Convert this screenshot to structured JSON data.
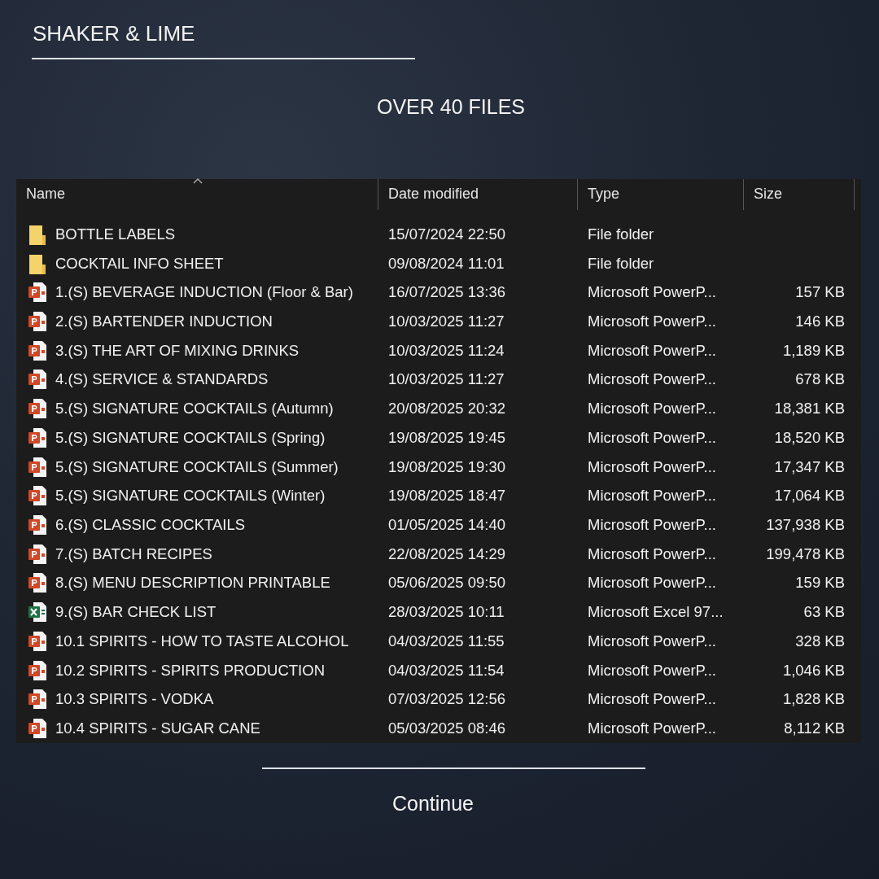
{
  "brand": "SHAKER & LIME",
  "heading": "OVER 40 FILES",
  "explorer": {
    "columns": [
      {
        "label": "Name",
        "sorted": true
      },
      {
        "label": "Date modified",
        "sorted": false
      },
      {
        "label": "Type",
        "sorted": false
      },
      {
        "label": "Size",
        "sorted": false
      }
    ],
    "rows": [
      {
        "kind": "folder",
        "name": "BOTTLE LABELS",
        "date": "15/07/2024 22:50",
        "type": "File folder"
      },
      {
        "kind": "folder",
        "name": "COCKTAIL INFO SHEET",
        "date": "09/08/2024 11:01",
        "type": "File folder"
      },
      {
        "kind": "powerpoint",
        "name": "1.(S) BEVERAGE INDUCTION (Floor & Bar)",
        "date": "16/07/2025 13:36",
        "type": "Microsoft PowerP...",
        "size": "157 KB"
      },
      {
        "kind": "powerpoint",
        "name": "2.(S) BARTENDER INDUCTION",
        "date": "10/03/2025 11:27",
        "type": "Microsoft PowerP...",
        "size": "146 KB"
      },
      {
        "kind": "powerpoint",
        "name": "3.(S) THE ART OF MIXING DRINKS",
        "date": "10/03/2025 11:24",
        "type": "Microsoft PowerP...",
        "size": "1,189 KB"
      },
      {
        "kind": "powerpoint",
        "name": "4.(S) SERVICE & STANDARDS",
        "date": "10/03/2025 11:27",
        "type": "Microsoft PowerP...",
        "size": "678 KB"
      },
      {
        "kind": "powerpoint",
        "name": "5.(S) SIGNATURE COCKTAILS (Autumn)",
        "date": "20/08/2025 20:32",
        "type": "Microsoft PowerP...",
        "size": "18,381 KB"
      },
      {
        "kind": "powerpoint",
        "name": "5.(S) SIGNATURE COCKTAILS (Spring)",
        "date": "19/08/2025 19:45",
        "type": "Microsoft PowerP...",
        "size": "18,520 KB"
      },
      {
        "kind": "powerpoint",
        "name": "5.(S) SIGNATURE COCKTAILS (Summer)",
        "date": "19/08/2025 19:30",
        "type": "Microsoft PowerP...",
        "size": "17,347 KB"
      },
      {
        "kind": "powerpoint",
        "name": "5.(S) SIGNATURE COCKTAILS (Winter)",
        "date": "19/08/2025 18:47",
        "type": "Microsoft PowerP...",
        "size": "17,064 KB"
      },
      {
        "kind": "powerpoint",
        "name": "6.(S) CLASSIC COCKTAILS",
        "date": "01/05/2025 14:40",
        "type": "Microsoft PowerP...",
        "size": "137,938 KB"
      },
      {
        "kind": "powerpoint",
        "name": "7.(S) BATCH RECIPES",
        "date": "22/08/2025 14:29",
        "type": "Microsoft PowerP...",
        "size": "199,478 KB"
      },
      {
        "kind": "powerpoint",
        "name": "8.(S) MENU DESCRIPTION PRINTABLE",
        "date": "05/06/2025 09:50",
        "type": "Microsoft PowerP...",
        "size": "159 KB"
      },
      {
        "kind": "excel",
        "name": "9.(S) BAR CHECK LIST",
        "date": "28/03/2025 10:11",
        "type": "Microsoft Excel 97...",
        "size": "63 KB"
      },
      {
        "kind": "powerpoint",
        "name": "10.1 SPIRITS - HOW TO TASTE ALCOHOL",
        "date": "04/03/2025 11:55",
        "type": "Microsoft PowerP...",
        "size": "328 KB"
      },
      {
        "kind": "powerpoint",
        "name": "10.2 SPIRITS - SPIRITS PRODUCTION",
        "date": "04/03/2025 11:54",
        "type": "Microsoft PowerP...",
        "size": "1,046 KB"
      },
      {
        "kind": "powerpoint",
        "name": "10.3 SPIRITS - VODKA",
        "date": "07/03/2025 12:56",
        "type": "Microsoft PowerP...",
        "size": "1,828 KB"
      },
      {
        "kind": "powerpoint",
        "name": "10.4 SPIRITS - SUGAR CANE",
        "date": "05/03/2025 08:46",
        "type": "Microsoft PowerP...",
        "size": "8,112 KB"
      }
    ]
  },
  "continue": "Continue"
}
